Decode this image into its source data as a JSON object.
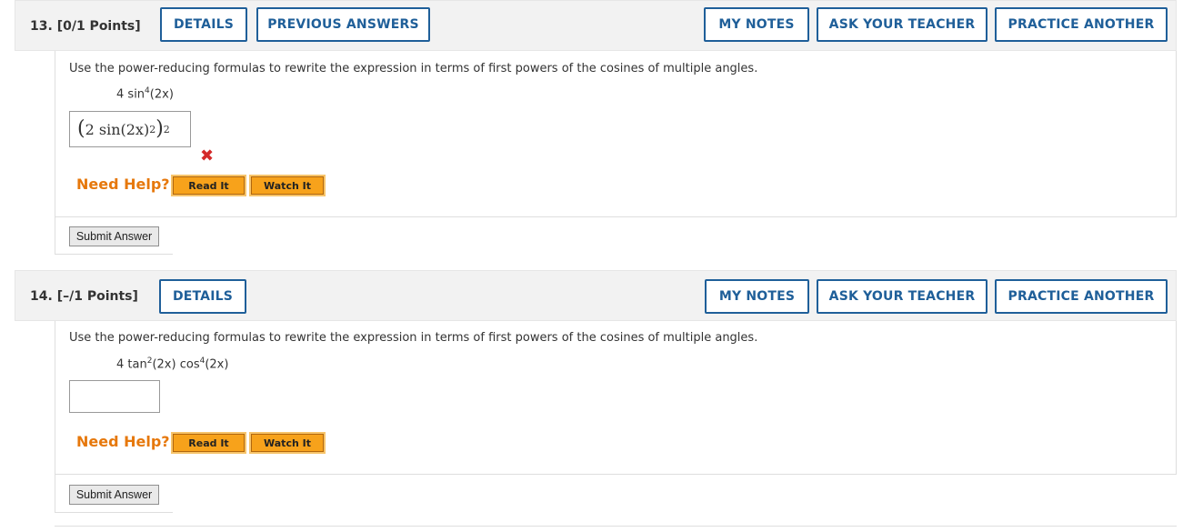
{
  "q13": {
    "number": "13.",
    "points": "[0/1 Points]",
    "buttons": {
      "details": "DETAILS",
      "previous_answers": "PREVIOUS ANSWERS",
      "my_notes": "MY NOTES",
      "ask_teacher": "ASK YOUR TEACHER",
      "practice_another": "PRACTICE ANOTHER"
    },
    "prompt": "Use the power-reducing formulas to rewrite the expression in terms of first powers of the cosines of multiple angles.",
    "expression": {
      "coef": "4",
      "func": "sin",
      "exp": "4",
      "arg": "(2x)"
    },
    "answer": {
      "inner": "2 sin",
      "arg": "(2x)",
      "exp_inner": "2",
      "exp_outer": "2"
    },
    "status": "incorrect",
    "need_help": "Need Help?",
    "read_it": "Read It",
    "watch_it": "Watch It",
    "submit": "Submit Answer"
  },
  "q14": {
    "number": "14.",
    "points": "[–/1 Points]",
    "buttons": {
      "details": "DETAILS",
      "my_notes": "MY NOTES",
      "ask_teacher": "ASK YOUR TEACHER",
      "practice_another": "PRACTICE ANOTHER"
    },
    "prompt": "Use the power-reducing formulas to rewrite the expression in terms of first powers of the cosines of multiple angles.",
    "expression": {
      "coef": "4",
      "func1": "tan",
      "exp1": "2",
      "arg1": "(2x)",
      "func2": "cos",
      "exp2": "4",
      "arg2": "(2x)"
    },
    "answer_value": "",
    "need_help": "Need Help?",
    "read_it": "Read It",
    "watch_it": "Watch It",
    "submit": "Submit Answer"
  },
  "colors": {
    "accent": "#1f5f99",
    "help": "#e6780c",
    "button_orange": "#f7a21b",
    "error": "#d42a2a"
  }
}
